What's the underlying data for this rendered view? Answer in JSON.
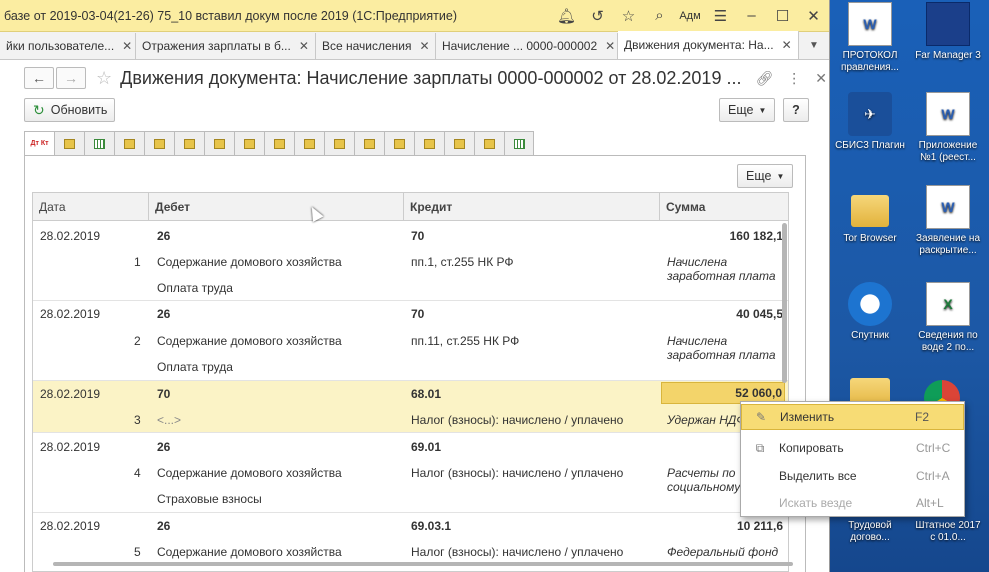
{
  "titlebar": {
    "title": "базе от 2019-03-04(21-26)  75_10 вставил докум после 2019  (1С:Предприятие)",
    "user": "Адм"
  },
  "tabs": [
    {
      "label": "йки пользователе..."
    },
    {
      "label": "Отражения зарплаты в б..."
    },
    {
      "label": "Все начисления"
    },
    {
      "label": "Начисление ... 0000-000002"
    },
    {
      "label": "Движения документа: На..."
    }
  ],
  "header": {
    "title": "Движения документа: Начисление зарплаты 0000-000002 от 28.02.2019 ..."
  },
  "toolbar": {
    "refresh": "Обновить",
    "more": "Еще",
    "help": "?",
    "more2": "Еще"
  },
  "reg_tab_first": "Дт Кт",
  "table": {
    "columns": {
      "date": "Дата",
      "debit": "Дебет",
      "credit": "Кредит",
      "sum": "Сумма"
    },
    "rows": [
      {
        "date": "28.02.2019",
        "n": "1",
        "debit": "26",
        "credit": "70",
        "sum": "160 182,1",
        "debit_sub1": "Содержание домового хозяйства",
        "debit_sub2": "Оплата труда",
        "credit_sub1": "пп.1, ст.255 НК РФ",
        "content": "Начислена заработная плата"
      },
      {
        "date": "28.02.2019",
        "n": "2",
        "debit": "26",
        "credit": "70",
        "sum": "40 045,5",
        "debit_sub1": "Содержание домового хозяйства",
        "debit_sub2": "Оплата труда",
        "credit_sub1": "пп.11, ст.255 НК РФ",
        "content": "Начислена заработная плата"
      },
      {
        "date": "28.02.2019",
        "n": "3",
        "debit": "70",
        "credit": "68.01",
        "sum": "52 060,0",
        "debit_sub1": "<...>",
        "debit_sub2": "",
        "credit_sub1": "Налог (взносы): начислено / уплачено",
        "content": "Удержан НДФ"
      },
      {
        "date": "28.02.2019",
        "n": "4",
        "debit": "26",
        "credit": "69.01",
        "sum": "",
        "debit_sub1": "Содержание домового хозяйства",
        "debit_sub2": "Страховые взносы",
        "credit_sub1": "Налог (взносы): начислено / уплачено",
        "content": "Расчеты по социальному"
      },
      {
        "date": "28.02.2019",
        "n": "5",
        "debit": "26",
        "credit": "69.03.1",
        "sum": "10 211,6",
        "debit_sub1": "Содержание домового хозяйства",
        "debit_sub2": "",
        "credit_sub1": "Налог (взносы): начислено / уплачено",
        "content": "Федеральный фонд"
      }
    ]
  },
  "context_menu": [
    {
      "label": "Изменить",
      "shortcut": "F2"
    },
    {
      "label": "Копировать",
      "shortcut": "Ctrl+C"
    },
    {
      "label": "Выделить все",
      "shortcut": "Ctrl+A"
    },
    {
      "label": "Искать везде",
      "shortcut": "Alt+L"
    }
  ],
  "desktop": [
    {
      "label": "ПРОТОКОЛ правления..."
    },
    {
      "label": "Far Manager 3"
    },
    {
      "label": "СБИС3 Плагин"
    },
    {
      "label": "Приложение №1 (реест..."
    },
    {
      "label": "Tor Browser"
    },
    {
      "label": "Заявление на раскрытие..."
    },
    {
      "label": "Спутник"
    },
    {
      "label": "Сведения по воде 2 по..."
    },
    {
      "label": "Трудовой догово..."
    },
    {
      "label": "Штатное 2017 с 01.0..."
    }
  ],
  "colors": {
    "titlebar": "#fbeda1",
    "selection": "#fbf3c6",
    "menu_highlight": "#f7dc75"
  }
}
